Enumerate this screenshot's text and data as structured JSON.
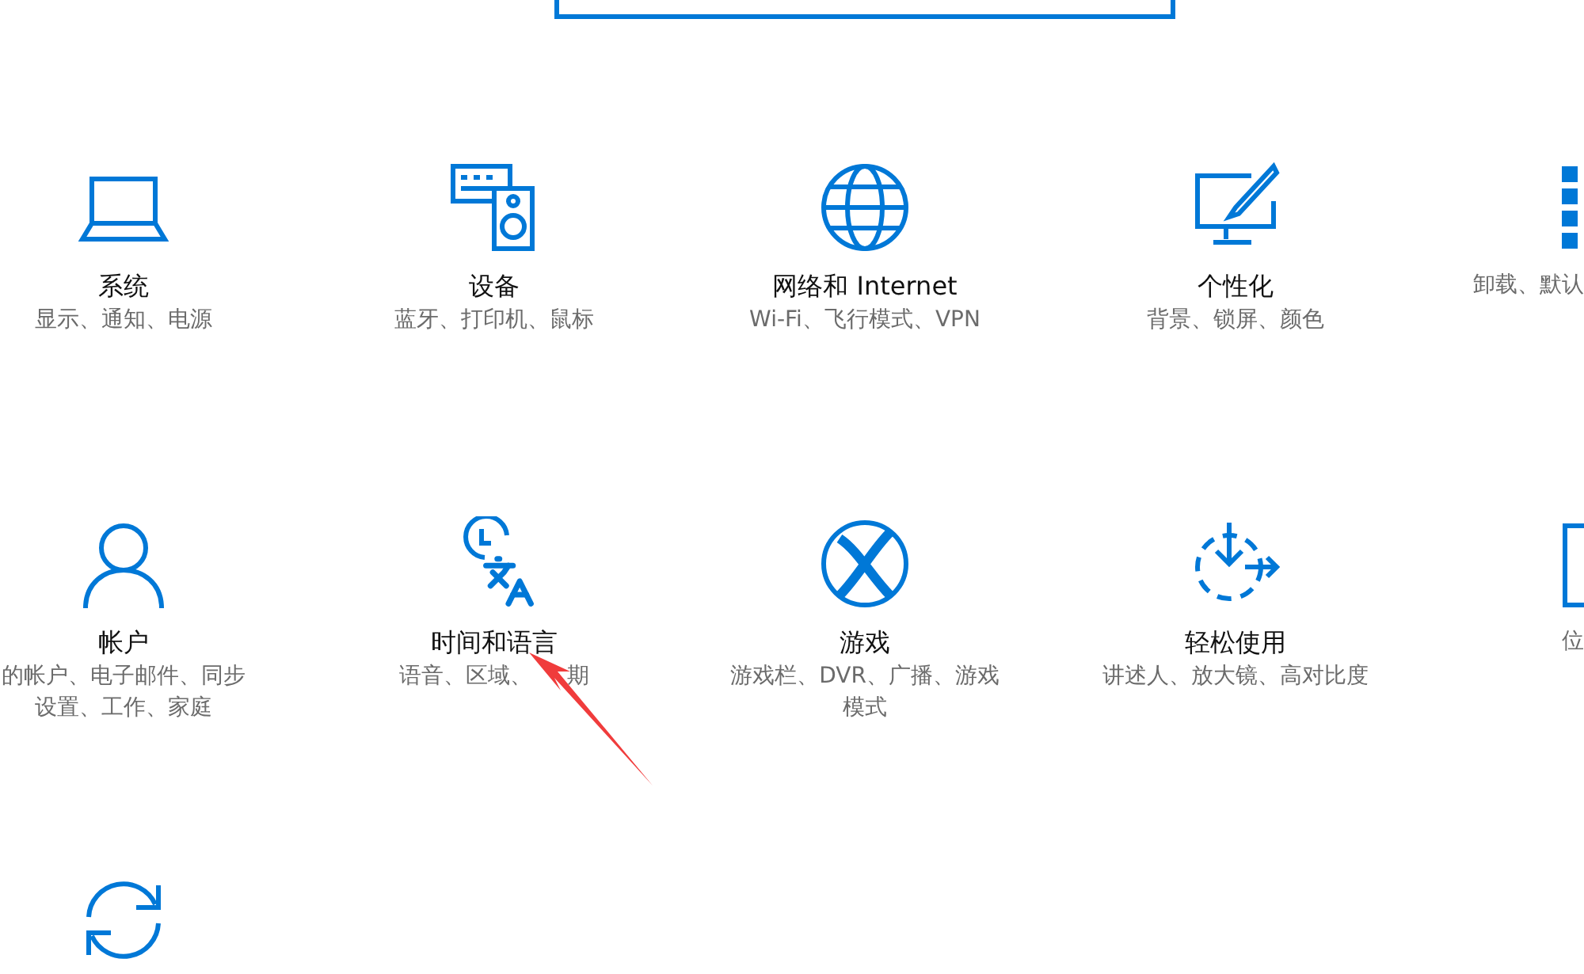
{
  "tiles": [
    [
      {
        "title": "系统",
        "lines": [
          "显示、通知、电源"
        ]
      },
      {
        "title": "设备",
        "lines": [
          "蓝牙、打印机、鼠标"
        ]
      },
      {
        "title": "网络和 Internet",
        "lines": [
          "Wi-Fi、飞行模式、VPN"
        ]
      },
      {
        "title": "个性化",
        "lines": [
          "背景、锁屏、颜色"
        ]
      },
      {
        "lines": [
          "卸载、默认"
        ]
      }
    ],
    [
      {
        "title": "帐户",
        "lines": [
          "的帐户、电子邮件、同步",
          "设置、工作、家庭"
        ]
      },
      {
        "title": "时间和语言",
        "lines": [
          [
            "语音、区域、",
            "期"
          ]
        ]
      },
      {
        "title": "游戏",
        "lines": [
          "游戏栏、DVR、广播、游戏",
          "模式"
        ]
      },
      {
        "title": "轻松使用",
        "lines": [
          "讲述人、放大镜、高对比度"
        ]
      },
      {
        "lines": [
          "位"
        ]
      }
    ]
  ]
}
